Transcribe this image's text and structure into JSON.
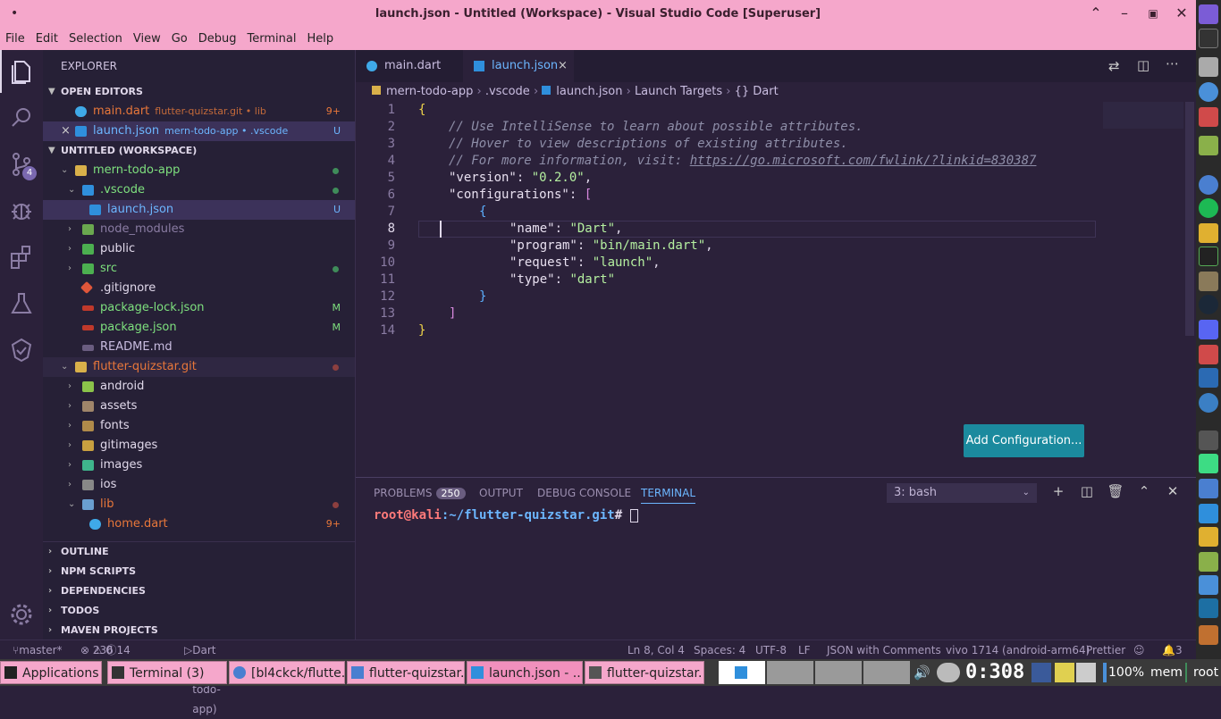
{
  "window": {
    "title": "launch.json - Untitled (Workspace) - Visual Studio Code [Superuser]",
    "dot": "•"
  },
  "menu": [
    "File",
    "Edit",
    "Selection",
    "View",
    "Go",
    "Debug",
    "Terminal",
    "Help"
  ],
  "activity": {
    "scm_badge": "4"
  },
  "sidebar": {
    "header": "EXPLORER",
    "open_editors": {
      "label": "OPEN EDITORS",
      "items": [
        {
          "name": "main.dart",
          "sub": "flutter-quizstar.git • lib",
          "badge": "9+"
        },
        {
          "name": "launch.json",
          "sub": "mern-todo-app • .vscode",
          "badge": "U",
          "close": "×"
        }
      ]
    },
    "workspace": {
      "label": "UNTITLED (WORKSPACE)",
      "rows": [
        {
          "name": "mern-todo-app",
          "badge": ""
        },
        {
          "name": ".vscode",
          "badge": ""
        },
        {
          "name": "launch.json",
          "badge": "U"
        },
        {
          "name": "node_modules",
          "badge": ""
        },
        {
          "name": "public",
          "badge": ""
        },
        {
          "name": "src",
          "badge": ""
        },
        {
          "name": ".gitignore",
          "badge": ""
        },
        {
          "name": "package-lock.json",
          "badge": "M"
        },
        {
          "name": "package.json",
          "badge": "M"
        },
        {
          "name": "README.md",
          "badge": ""
        },
        {
          "name": "flutter-quizstar.git",
          "badge": ""
        },
        {
          "name": "android",
          "badge": ""
        },
        {
          "name": "assets",
          "badge": ""
        },
        {
          "name": "fonts",
          "badge": ""
        },
        {
          "name": "gitimages",
          "badge": ""
        },
        {
          "name": "images",
          "badge": ""
        },
        {
          "name": "ios",
          "badge": ""
        },
        {
          "name": "lib",
          "badge": ""
        },
        {
          "name": "home.dart",
          "badge": "9+"
        }
      ]
    },
    "sections": [
      "OUTLINE",
      "NPM SCRIPTS",
      "DEPENDENCIES",
      "TODOS",
      "MAVEN PROJECTS"
    ]
  },
  "tabs": [
    {
      "label": "main.dart"
    },
    {
      "label": "launch.json",
      "close": "×"
    }
  ],
  "breadcrumb": [
    "mern-todo-app",
    ".vscode",
    "launch.json",
    "Launch Targets",
    "{} Dart"
  ],
  "code": {
    "line_numbers": [
      "1",
      "2",
      "3",
      "4",
      "5",
      "6",
      "7",
      "8",
      "9",
      "10",
      "11",
      "12",
      "13",
      "14"
    ],
    "l2": "// Use IntelliSense to learn about possible attributes.",
    "l3": "// Hover to view descriptions of existing attributes.",
    "l4a": "// For more information, visit: ",
    "l4b": "https://go.microsoft.com/fwlink/?linkid=830387",
    "version_key": "\"version\"",
    "version_val": "\"0.2.0\"",
    "conf_key": "\"configurations\"",
    "name_key": "\"name\"",
    "name_val": "\"Dart\"",
    "prog_key": "\"program\"",
    "prog_val": "\"bin/main.dart\"",
    "req_key": "\"request\"",
    "req_val": "\"launch\"",
    "type_key": "\"type\"",
    "type_val": "\"dart\""
  },
  "add_config": "Add Configuration...",
  "panel": {
    "tabs": [
      "PROBLEMS",
      "OUTPUT",
      "DEBUG CONSOLE",
      "TERMINAL"
    ],
    "problems_count": "250",
    "shell": "3: bash",
    "prompt_user": "root@kali",
    "prompt_path": ":~/flutter-quizstar.git",
    "prompt_sym": "# "
  },
  "status": {
    "branch": "master*",
    "errors": "236",
    "warnings": "0",
    "info": "14",
    "debug": "Dart (mern-todo-app)",
    "position": "Ln 8, Col 4",
    "spaces": "Spaces: 4",
    "encoding": "UTF-8",
    "eol": "LF",
    "lang": "JSON with Comments",
    "device": "vivo 1714 (android-arm64)",
    "formatter": "Prettier",
    "bell": "3"
  },
  "taskbar": {
    "apps": "Applications",
    "items": [
      "Terminal (3)",
      "[bl4ckck/flutte...",
      "flutter-quizstar...",
      "launch.json - ...",
      "flutter-quizstar..."
    ],
    "clock": "0:308",
    "battery": "100%",
    "mem": "mem",
    "user": "root"
  }
}
